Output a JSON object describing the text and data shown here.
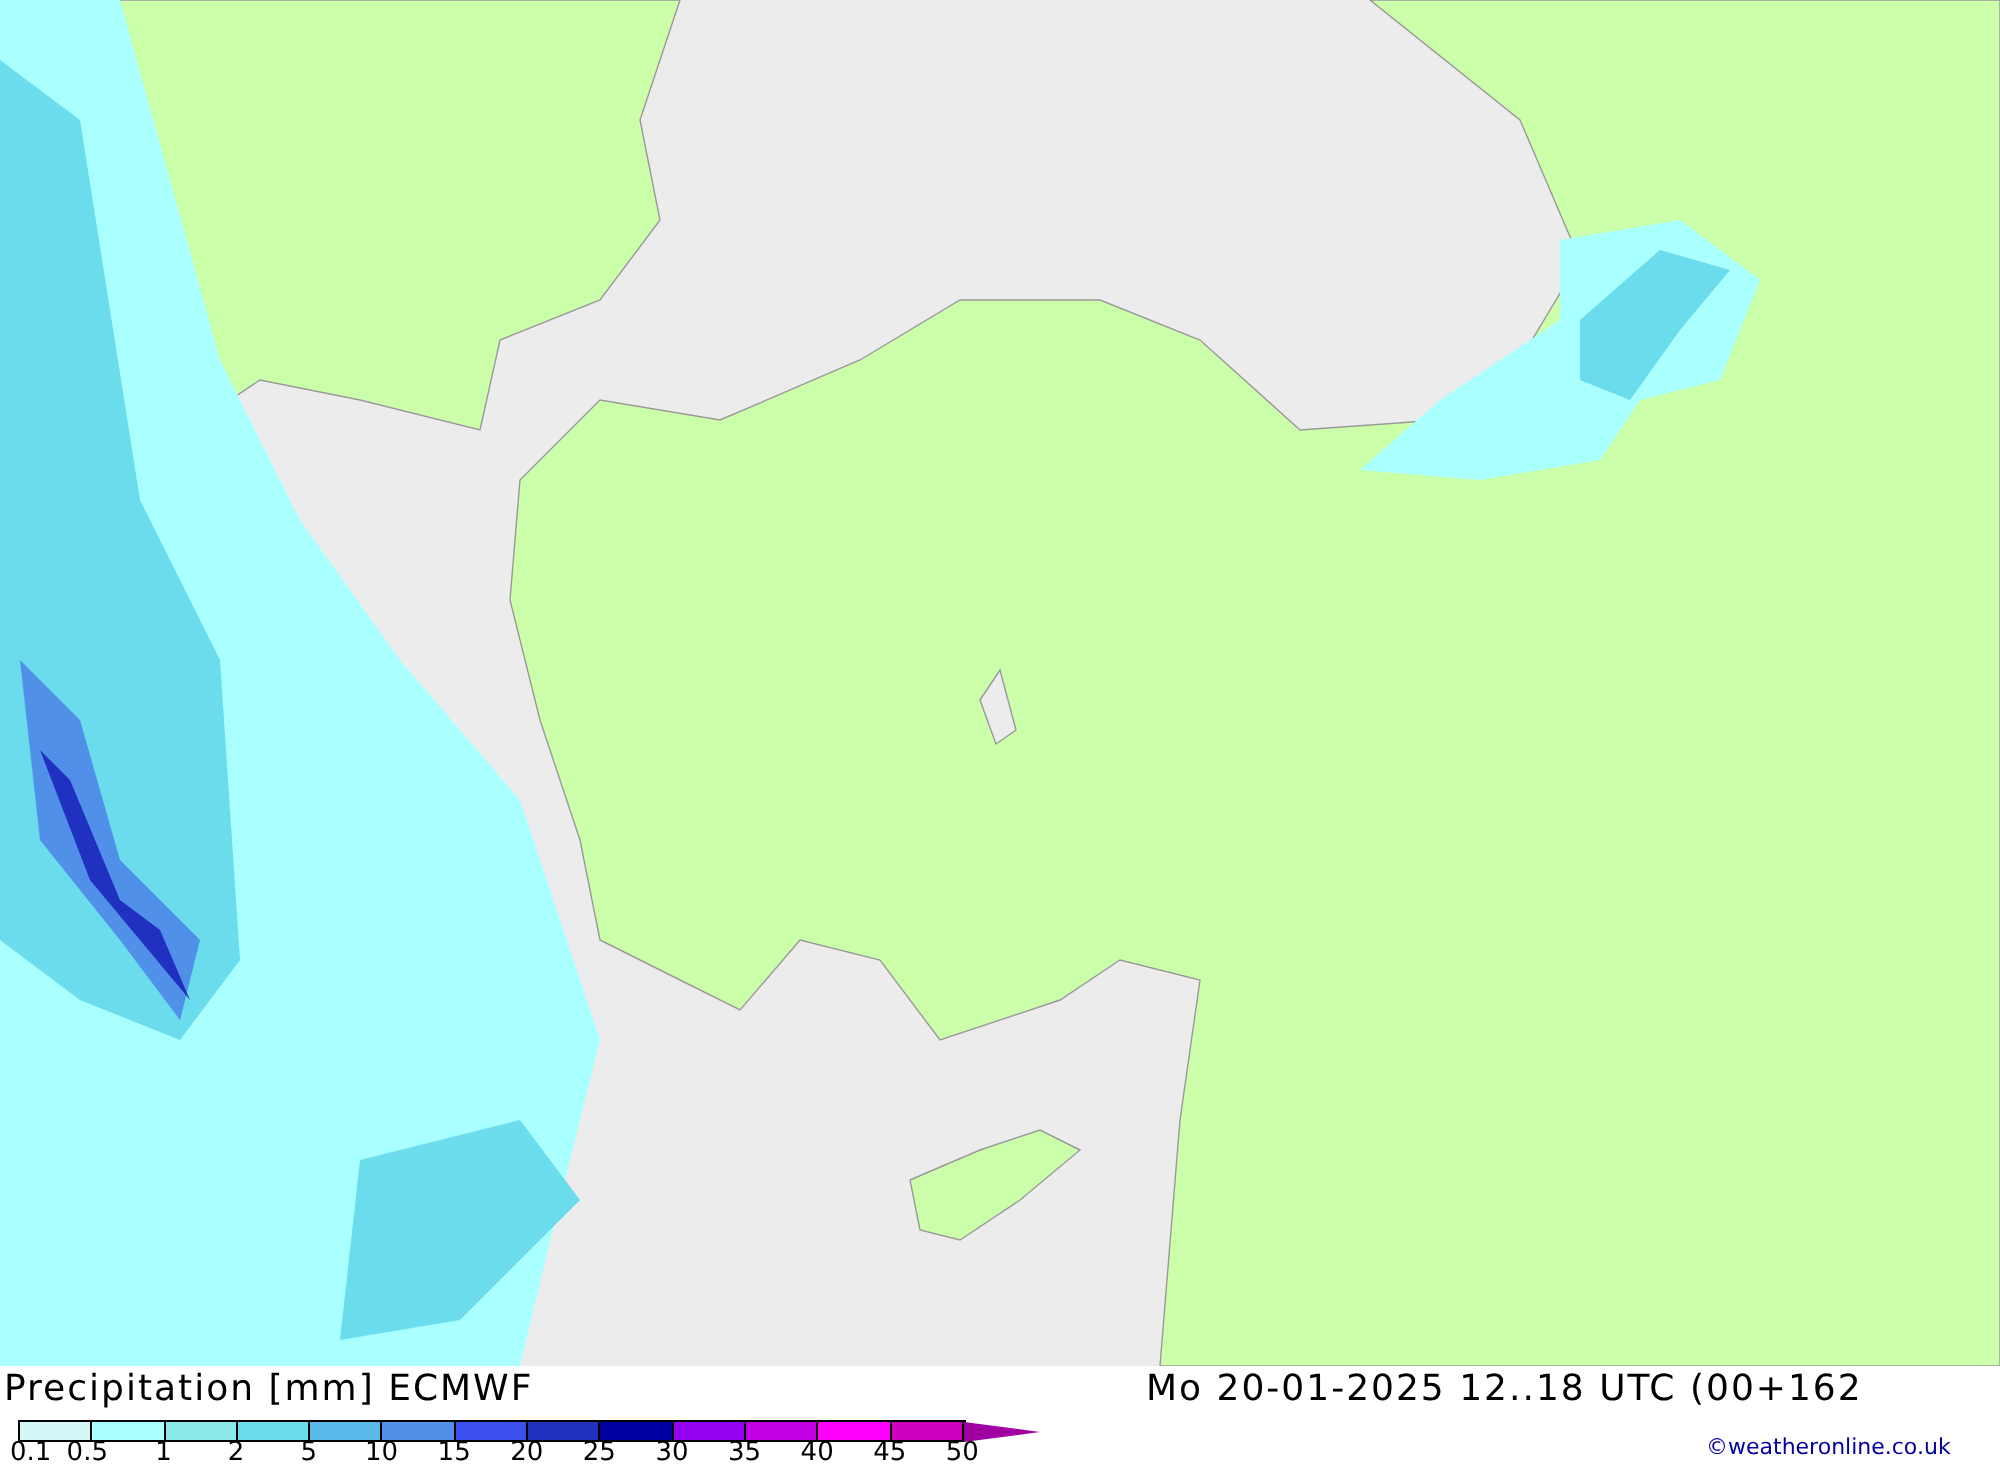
{
  "map": {
    "kind": "precipitation"
  },
  "title": "Precipitation [mm] ECMWF",
  "valid_time": "Mo 20-01-2025 12..18 UTC (00+162",
  "legend": {
    "swatches": [
      {
        "color": "#d4f8f8"
      },
      {
        "color": "#aaffff"
      },
      {
        "color": "#8aeaea"
      },
      {
        "color": "#6adcec"
      },
      {
        "color": "#5ab8e8"
      },
      {
        "color": "#5090e8"
      },
      {
        "color": "#3c50f0"
      },
      {
        "color": "#2030c0"
      },
      {
        "color": "#0000a0"
      },
      {
        "color": "#9600f0"
      },
      {
        "color": "#c000e0"
      },
      {
        "color": "#ff00ff"
      },
      {
        "color": "#d000c0"
      }
    ],
    "over_arrow": {
      "color": "#a000a0"
    },
    "labels": [
      "0.1",
      "0.5",
      "1",
      "2",
      "5",
      "10",
      "15",
      "20",
      "25",
      "30",
      "35",
      "40",
      "45",
      "50"
    ]
  },
  "credit": "©weatheronline.co.uk"
}
